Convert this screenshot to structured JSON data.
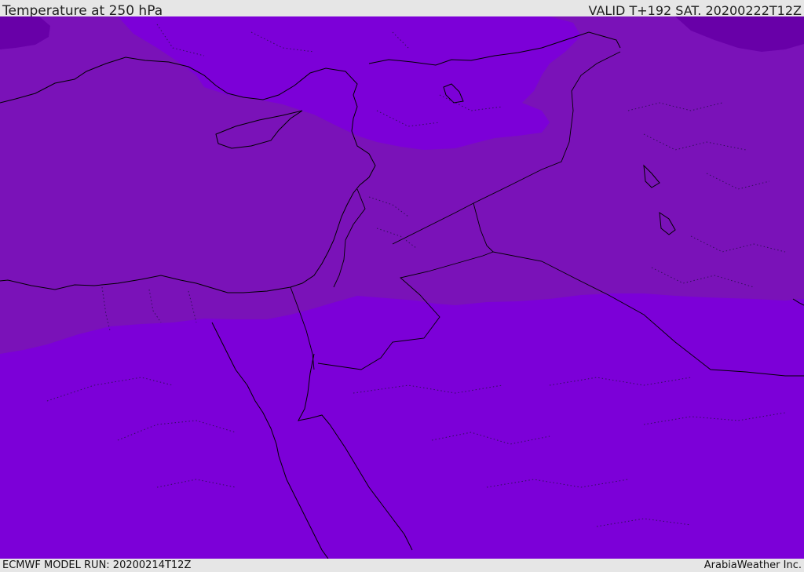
{
  "header": {
    "title": "Temperature at 250 hPa",
    "valid": "VALID T+192 SAT. 20200222T12Z"
  },
  "footer": {
    "model_run": "ECMWF MODEL RUN: 20200214T12Z",
    "credit": "ArabiaWeather Inc."
  },
  "colors": {
    "band_cold": "#6800a8",
    "band_mid": "#7a12b8",
    "band_warm": "#7c00d8",
    "coastline": "#000000",
    "background": "#e6e6e6"
  }
}
